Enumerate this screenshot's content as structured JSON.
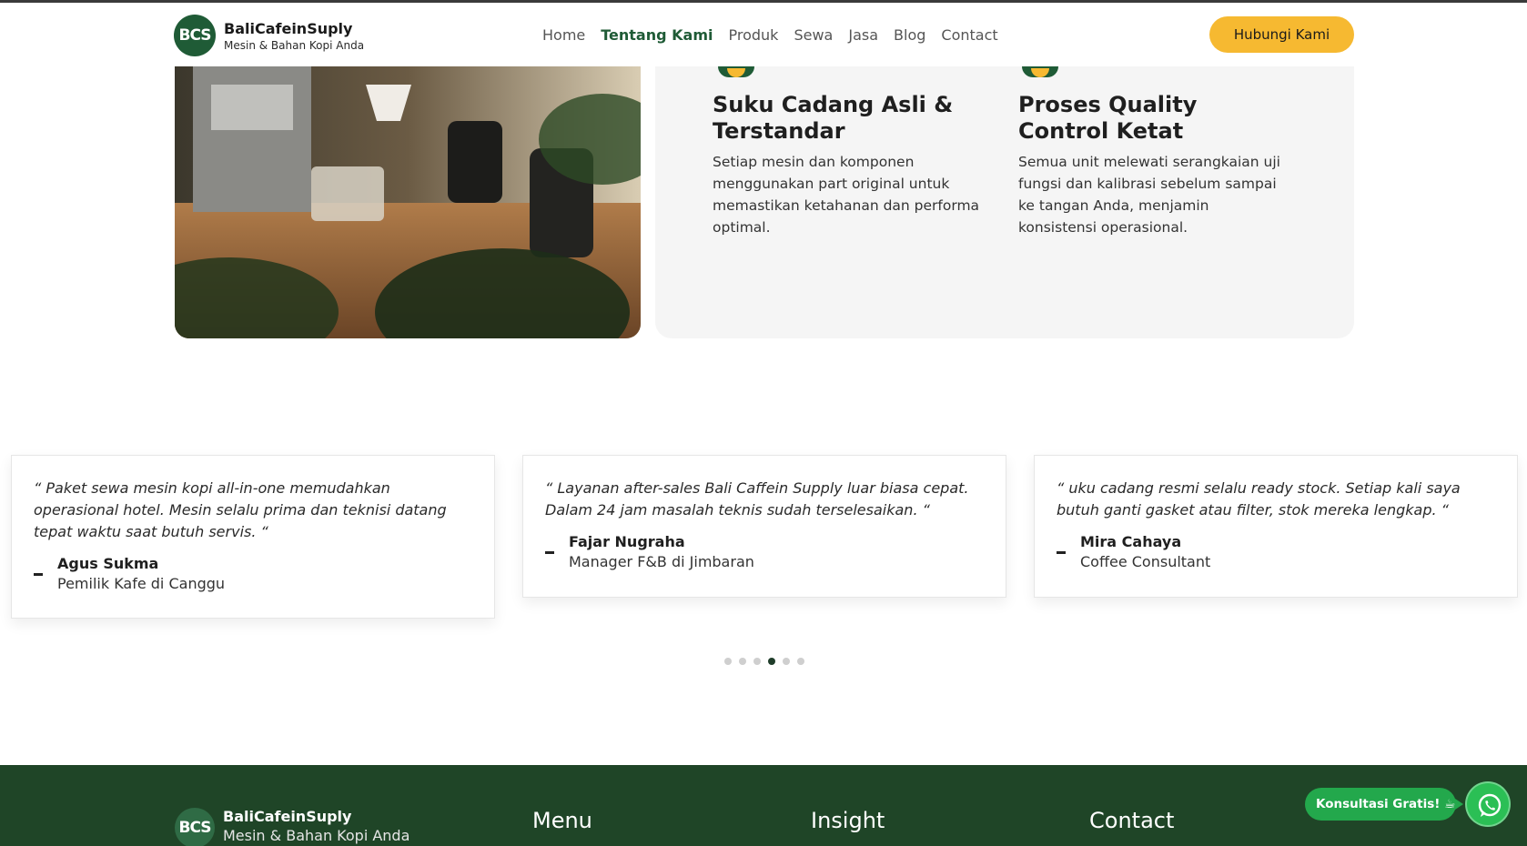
{
  "header": {
    "logo_mark": "BCS",
    "brand": "BaliCafeinSuply",
    "tagline": "Mesin & Bahan Kopi Anda",
    "nav": [
      {
        "label": "Home",
        "active": false
      },
      {
        "label": "Tentang Kami",
        "active": true
      },
      {
        "label": "Produk",
        "active": false
      },
      {
        "label": "Sewa",
        "active": false
      },
      {
        "label": "Jasa",
        "active": false
      },
      {
        "label": "Blog",
        "active": false
      },
      {
        "label": "Contact",
        "active": false
      }
    ],
    "cta_label": "Hubungi Kami"
  },
  "features": [
    {
      "title": "Suku Cadang Asli & Terstandar",
      "description": "Setiap mesin dan komponen menggunakan part original untuk memastikan ketahanan dan performa optimal."
    },
    {
      "title": "Proses Quality Control Ketat",
      "description": "Semua unit melewati serangkaian uji fungsi dan kalibrasi sebelum sampai ke tangan Anda, menjamin konsistensi operasional."
    }
  ],
  "testimonials": [
    {
      "quote": "“ Paket sewa mesin kopi all-in-one memudahkan operasional hotel. Mesin selalu prima dan teknisi datang tepat waktu saat butuh servis. “",
      "name": "Agus Sukma",
      "role": "Pemilik Kafe di Canggu"
    },
    {
      "quote": "“ Layanan after-sales Bali Caffein Supply luar biasa cepat. Dalam 24 jam masalah teknis sudah terselesaikan. “",
      "name": "Fajar Nugraha",
      "role": "Manager F&B di Jimbaran"
    },
    {
      "quote": "“ uku cadang resmi selalu ready stock. Setiap kali saya butuh ganti gasket atau filter, stok mereka lengkap. “",
      "name": "Mira Cahaya",
      "role": "Coffee Consultant"
    }
  ],
  "carousel": {
    "count": 6,
    "active_index": 3
  },
  "footer": {
    "brand": "BaliCafeinSuply",
    "tagline": "Mesin & Bahan Kopi Anda",
    "columns": [
      "Menu",
      "Insight",
      "Contact"
    ]
  },
  "whatsapp": {
    "label": "Konsultasi Gratis! ☕"
  },
  "colors": {
    "brand_green": "#1f5b36",
    "accent_yellow": "#f6b931",
    "footer_green": "#1f4527",
    "whatsapp_green": "#2bbf55"
  }
}
